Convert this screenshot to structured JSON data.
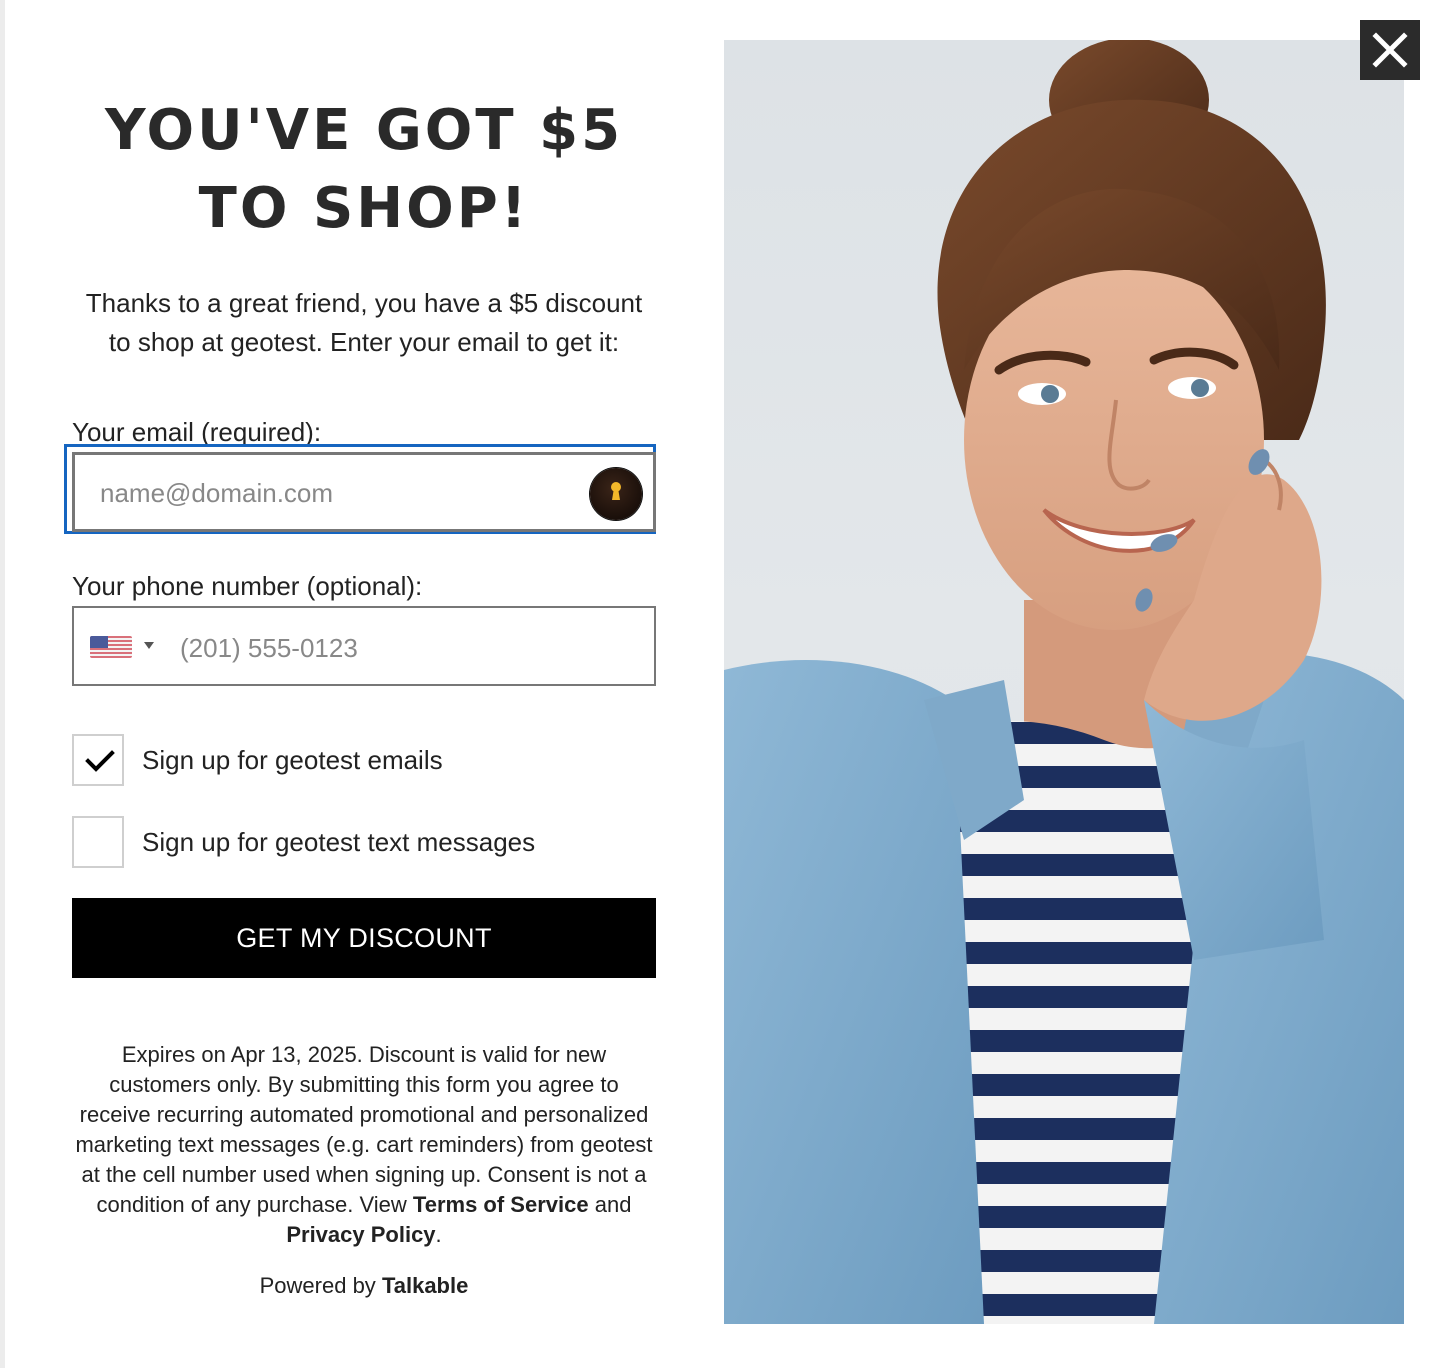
{
  "headline": {
    "line1": "YOU'VE GOT $5",
    "line2": "TO SHOP!"
  },
  "subtitle": "Thanks to a great friend, you have a $5 discount to shop at geotest. Enter your email to get it:",
  "email": {
    "label": "Your email (required):",
    "placeholder": "name@domain.com",
    "value": ""
  },
  "phone": {
    "label": "Your phone number (optional):",
    "placeholder": "(201) 555-0123",
    "value": "",
    "country": "US"
  },
  "checkboxes": [
    {
      "label": "Sign up for geotest emails",
      "checked": true
    },
    {
      "label": "Sign up for geotest text messages",
      "checked": false
    }
  ],
  "submit_label": "GET MY DISCOUNT",
  "legal": {
    "text": "Expires on Apr 13, 2025. Discount is valid for new customers only. By submitting this form you agree to receive recurring automated promotional and personalized marketing text messages (e.g. cart reminders) from geotest at the cell number used when signing up. Consent is not a condition of any purchase. View",
    "terms_link": "Terms of Service",
    "and": "and",
    "privacy_link": "Privacy Policy",
    "period": "."
  },
  "powered": {
    "prefix": "Powered by",
    "brand": "Talkable"
  },
  "icons": {
    "close": "close-icon",
    "password_manager": "keyhole-icon",
    "flag": "us-flag-icon",
    "caret": "caret-down-icon",
    "check": "checkmark-icon"
  },
  "colors": {
    "button_bg": "#000000",
    "focus_ring": "#1565c0",
    "close_bg": "#2b2b2b"
  }
}
